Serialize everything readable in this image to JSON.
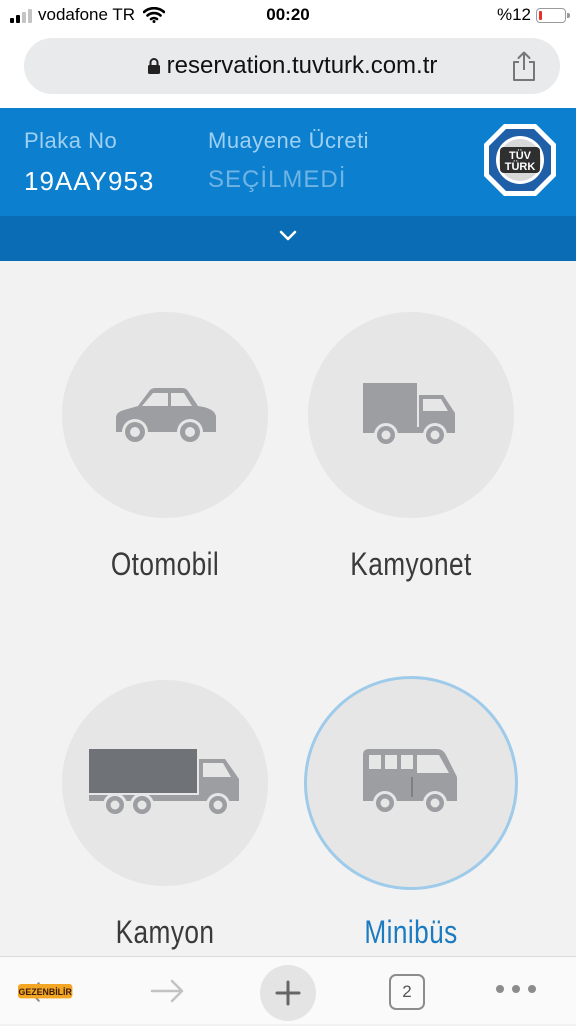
{
  "status_bar": {
    "carrier": "vodafone TR",
    "time": "00:20",
    "battery_text": "%12",
    "battery_level": 0.12
  },
  "browser": {
    "url": "reservation.tuvturk.com.tr",
    "tab_count": "2"
  },
  "header": {
    "plate_label": "Plaka No",
    "plate_value": "19AAY953",
    "fee_label": "Muayene Ücreti",
    "fee_value": "SEÇİLMEDİ",
    "logo_text_top": "TÜV",
    "logo_text_bottom": "TÜRK"
  },
  "vehicles": [
    {
      "label": "Otomobil",
      "icon": "car-icon",
      "selected": false
    },
    {
      "label": "Kamyonet",
      "icon": "van-icon",
      "selected": false
    },
    {
      "label": "Kamyon",
      "icon": "truck-icon",
      "selected": false
    },
    {
      "label": "Minibüs",
      "icon": "minibus-icon",
      "selected": true
    }
  ],
  "colors": {
    "header_blue": "#0c7fcf",
    "header_dark_blue": "#0a6cb4",
    "selected_text": "#1b7bc0",
    "icon_gray": "#9c9ea2"
  },
  "watermark": "GEZENBİLİR"
}
